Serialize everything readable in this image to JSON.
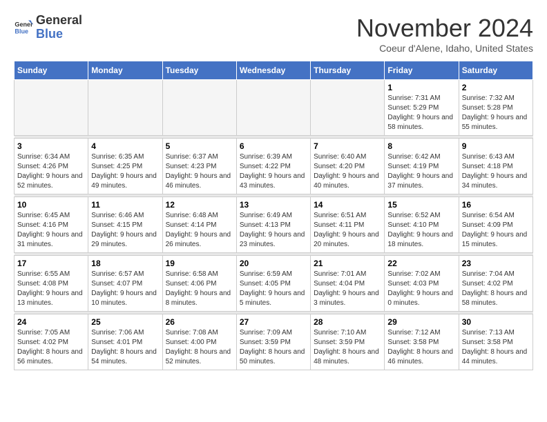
{
  "logo": {
    "line1": "General",
    "line2": "Blue"
  },
  "title": "November 2024",
  "location": "Coeur d'Alene, Idaho, United States",
  "days_of_week": [
    "Sunday",
    "Monday",
    "Tuesday",
    "Wednesday",
    "Thursday",
    "Friday",
    "Saturday"
  ],
  "weeks": [
    [
      {
        "day": "",
        "info": ""
      },
      {
        "day": "",
        "info": ""
      },
      {
        "day": "",
        "info": ""
      },
      {
        "day": "",
        "info": ""
      },
      {
        "day": "",
        "info": ""
      },
      {
        "day": "1",
        "info": "Sunrise: 7:31 AM\nSunset: 5:29 PM\nDaylight: 9 hours and 58 minutes."
      },
      {
        "day": "2",
        "info": "Sunrise: 7:32 AM\nSunset: 5:28 PM\nDaylight: 9 hours and 55 minutes."
      }
    ],
    [
      {
        "day": "3",
        "info": "Sunrise: 6:34 AM\nSunset: 4:26 PM\nDaylight: 9 hours and 52 minutes."
      },
      {
        "day": "4",
        "info": "Sunrise: 6:35 AM\nSunset: 4:25 PM\nDaylight: 9 hours and 49 minutes."
      },
      {
        "day": "5",
        "info": "Sunrise: 6:37 AM\nSunset: 4:23 PM\nDaylight: 9 hours and 46 minutes."
      },
      {
        "day": "6",
        "info": "Sunrise: 6:39 AM\nSunset: 4:22 PM\nDaylight: 9 hours and 43 minutes."
      },
      {
        "day": "7",
        "info": "Sunrise: 6:40 AM\nSunset: 4:20 PM\nDaylight: 9 hours and 40 minutes."
      },
      {
        "day": "8",
        "info": "Sunrise: 6:42 AM\nSunset: 4:19 PM\nDaylight: 9 hours and 37 minutes."
      },
      {
        "day": "9",
        "info": "Sunrise: 6:43 AM\nSunset: 4:18 PM\nDaylight: 9 hours and 34 minutes."
      }
    ],
    [
      {
        "day": "10",
        "info": "Sunrise: 6:45 AM\nSunset: 4:16 PM\nDaylight: 9 hours and 31 minutes."
      },
      {
        "day": "11",
        "info": "Sunrise: 6:46 AM\nSunset: 4:15 PM\nDaylight: 9 hours and 29 minutes."
      },
      {
        "day": "12",
        "info": "Sunrise: 6:48 AM\nSunset: 4:14 PM\nDaylight: 9 hours and 26 minutes."
      },
      {
        "day": "13",
        "info": "Sunrise: 6:49 AM\nSunset: 4:13 PM\nDaylight: 9 hours and 23 minutes."
      },
      {
        "day": "14",
        "info": "Sunrise: 6:51 AM\nSunset: 4:11 PM\nDaylight: 9 hours and 20 minutes."
      },
      {
        "day": "15",
        "info": "Sunrise: 6:52 AM\nSunset: 4:10 PM\nDaylight: 9 hours and 18 minutes."
      },
      {
        "day": "16",
        "info": "Sunrise: 6:54 AM\nSunset: 4:09 PM\nDaylight: 9 hours and 15 minutes."
      }
    ],
    [
      {
        "day": "17",
        "info": "Sunrise: 6:55 AM\nSunset: 4:08 PM\nDaylight: 9 hours and 13 minutes."
      },
      {
        "day": "18",
        "info": "Sunrise: 6:57 AM\nSunset: 4:07 PM\nDaylight: 9 hours and 10 minutes."
      },
      {
        "day": "19",
        "info": "Sunrise: 6:58 AM\nSunset: 4:06 PM\nDaylight: 9 hours and 8 minutes."
      },
      {
        "day": "20",
        "info": "Sunrise: 6:59 AM\nSunset: 4:05 PM\nDaylight: 9 hours and 5 minutes."
      },
      {
        "day": "21",
        "info": "Sunrise: 7:01 AM\nSunset: 4:04 PM\nDaylight: 9 hours and 3 minutes."
      },
      {
        "day": "22",
        "info": "Sunrise: 7:02 AM\nSunset: 4:03 PM\nDaylight: 9 hours and 0 minutes."
      },
      {
        "day": "23",
        "info": "Sunrise: 7:04 AM\nSunset: 4:02 PM\nDaylight: 8 hours and 58 minutes."
      }
    ],
    [
      {
        "day": "24",
        "info": "Sunrise: 7:05 AM\nSunset: 4:02 PM\nDaylight: 8 hours and 56 minutes."
      },
      {
        "day": "25",
        "info": "Sunrise: 7:06 AM\nSunset: 4:01 PM\nDaylight: 8 hours and 54 minutes."
      },
      {
        "day": "26",
        "info": "Sunrise: 7:08 AM\nSunset: 4:00 PM\nDaylight: 8 hours and 52 minutes."
      },
      {
        "day": "27",
        "info": "Sunrise: 7:09 AM\nSunset: 3:59 PM\nDaylight: 8 hours and 50 minutes."
      },
      {
        "day": "28",
        "info": "Sunrise: 7:10 AM\nSunset: 3:59 PM\nDaylight: 8 hours and 48 minutes."
      },
      {
        "day": "29",
        "info": "Sunrise: 7:12 AM\nSunset: 3:58 PM\nDaylight: 8 hours and 46 minutes."
      },
      {
        "day": "30",
        "info": "Sunrise: 7:13 AM\nSunset: 3:58 PM\nDaylight: 8 hours and 44 minutes."
      }
    ]
  ]
}
